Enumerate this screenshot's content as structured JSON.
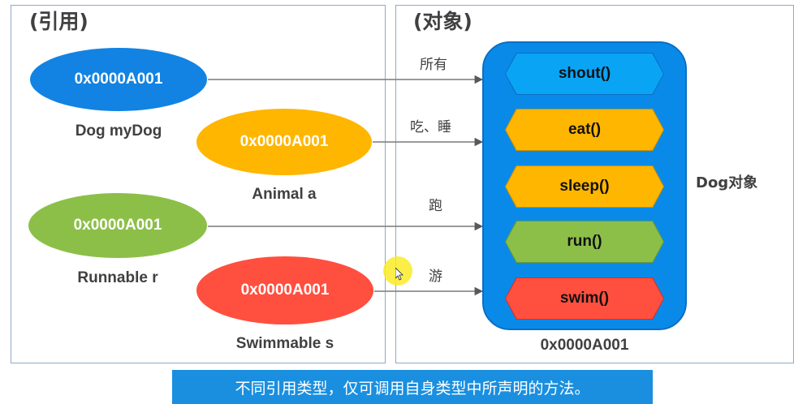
{
  "titles": {
    "references": "(引用)",
    "object": "(对象)"
  },
  "references": [
    {
      "address": "0x0000A001",
      "label": "Dog myDog",
      "color": "#1283e2"
    },
    {
      "address": "0x0000A001",
      "label": "Animal a",
      "color": "#ffb600"
    },
    {
      "address": "0x0000A001",
      "label": "Runnable r",
      "color": "#8cbf48"
    },
    {
      "address": "0x0000A001",
      "label": "Swimmable s",
      "color": "#ff4f3f"
    }
  ],
  "arrows": [
    {
      "label": "所有"
    },
    {
      "label": "吃、睡"
    },
    {
      "label": "跑"
    },
    {
      "label": "游"
    }
  ],
  "methods": [
    {
      "name": "shout()",
      "color": "#0aa4f5"
    },
    {
      "name": "eat()",
      "color": "#ffb600"
    },
    {
      "name": "sleep()",
      "color": "#ffb600"
    },
    {
      "name": "run()",
      "color": "#8cbf48"
    },
    {
      "name": "swim()",
      "color": "#ff4f3f"
    }
  ],
  "object": {
    "label": "Dog对象",
    "address": "0x0000A001",
    "color": "#0a8ae8"
  },
  "caption": "不同引用类型，仅可调用自身类型中所声明的方法。"
}
